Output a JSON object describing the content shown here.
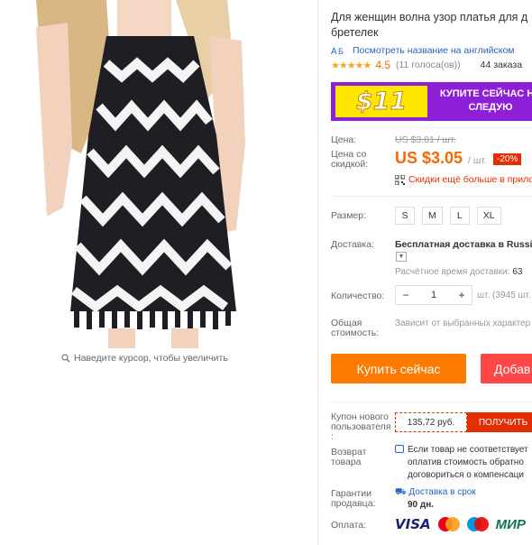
{
  "gallery": {
    "zoom_hint": "Наведите курсор, чтобы увеличить"
  },
  "product": {
    "title": "Для женщин волна узор платья для д",
    "title_line2": "бретелек",
    "translate_link": "Посмотреть название на английском",
    "rating_value": "4.5",
    "votes": "(11 голоса(ов))",
    "orders": "44 заказа"
  },
  "banner": {
    "price": "$11",
    "text": "КУПИТЕ СЕЙЧАС НА СЛЕДУЮ"
  },
  "price": {
    "label": "Цена:",
    "old": "US $3.81 / шт.",
    "discount_label": "Цена со скидкой:",
    "current": "US $3.05",
    "unit": "/ шт.",
    "discount_badge": "-20%",
    "app_promo": "Скидки ещё больше в прило"
  },
  "size": {
    "label": "Размер:",
    "options": [
      "S",
      "M",
      "L",
      "XL"
    ]
  },
  "shipping": {
    "label": "Доставка:",
    "value": "Бесплатная доставка в Russia",
    "eta_label": "Расчётное время доставки:",
    "eta_value": "63"
  },
  "quantity": {
    "label": "Количество:",
    "minus": "−",
    "value": "1",
    "plus": "+",
    "note": "шт. (3945 шт."
  },
  "total": {
    "label": "Общая стоимость:",
    "value": "Зависит от выбранных характер"
  },
  "actions": {
    "buy": "Купить сейчас",
    "cart": "Добав"
  },
  "coupon": {
    "label": "Купон нового пользователя :",
    "amount": "135,72 руб.",
    "button": "ПОЛУЧИТЬ"
  },
  "returns": {
    "label": "Возврат товара",
    "line1": "Если товар не соответствует",
    "line2": "оплатив стоимость обратно",
    "line3": "договориться о компенсаци"
  },
  "guarantee": {
    "label": "Гарантии продавца:",
    "line1": "Доставка в срок",
    "line2": "90 дн."
  },
  "payment": {
    "label": "Оплата:",
    "methods": [
      "VISA",
      "MasterCard",
      "Maestro",
      "МИР"
    ]
  },
  "colors": {
    "accent_orange": "#ff7a00",
    "price_orange": "#ff6600",
    "red": "#e62e04",
    "link_blue": "#2962c1",
    "banner_purple": "#8d1fd6",
    "banner_yellow": "#ffe600"
  }
}
